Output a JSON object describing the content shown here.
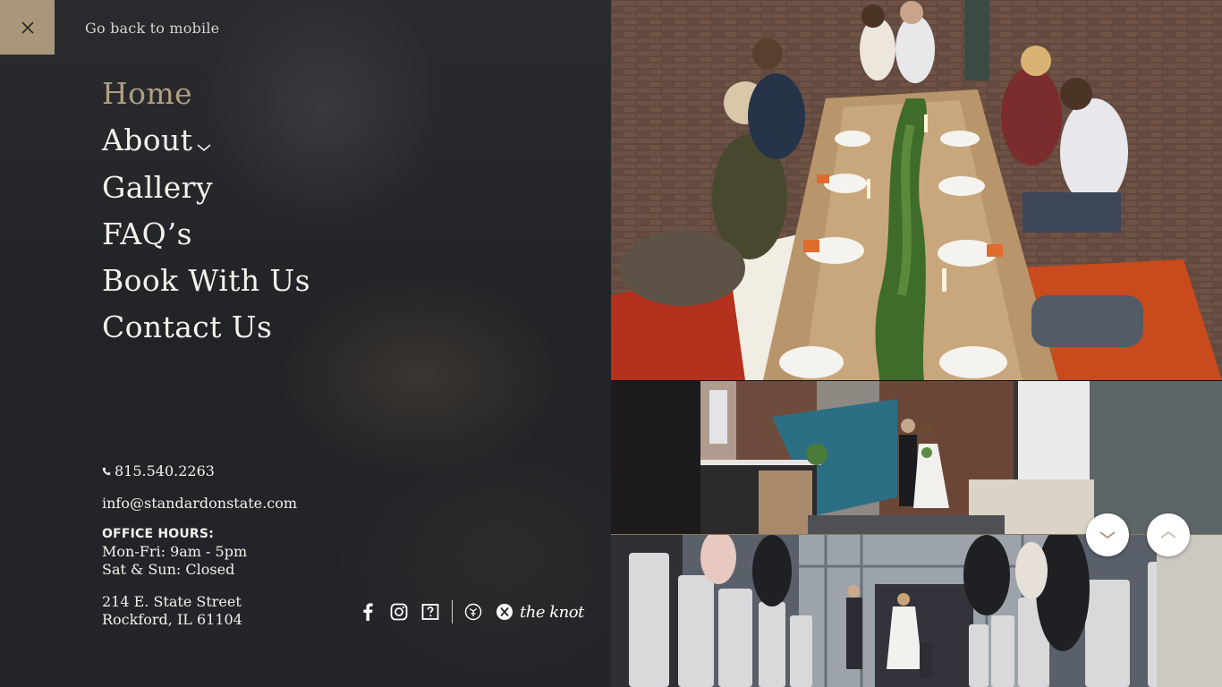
{
  "header": {
    "go_back_label": "Go back to mobile",
    "close_icon": "close-icon"
  },
  "nav": {
    "items": [
      {
        "label": "Home",
        "active": true
      },
      {
        "label": "About",
        "has_dropdown": true
      },
      {
        "label": "Gallery"
      },
      {
        "label": "FAQ’s"
      },
      {
        "label": "Book With Us"
      },
      {
        "label": "Contact Us"
      }
    ]
  },
  "contact": {
    "phone": "815.540.2263",
    "email": "info@standardonstate.com",
    "hours_title": "OFFICE HOURS:",
    "hours_weekdays": "Mon-Fri: 9am - 5pm",
    "hours_weekend": "Sat & Sun: Closed",
    "address_line1": "214 E. State Street",
    "address_line2": "Rockford, IL 61104"
  },
  "social": {
    "icons": [
      "facebook-icon",
      "instagram-icon",
      "question-icon",
      "weddingwire-icon",
      "the-knot-icon"
    ],
    "knot_label": "the knot"
  },
  "colors": {
    "accent": "#a8977a",
    "active_nav": "#b09f80",
    "panel_bg": "#232428",
    "text": "#f3f1ec"
  }
}
